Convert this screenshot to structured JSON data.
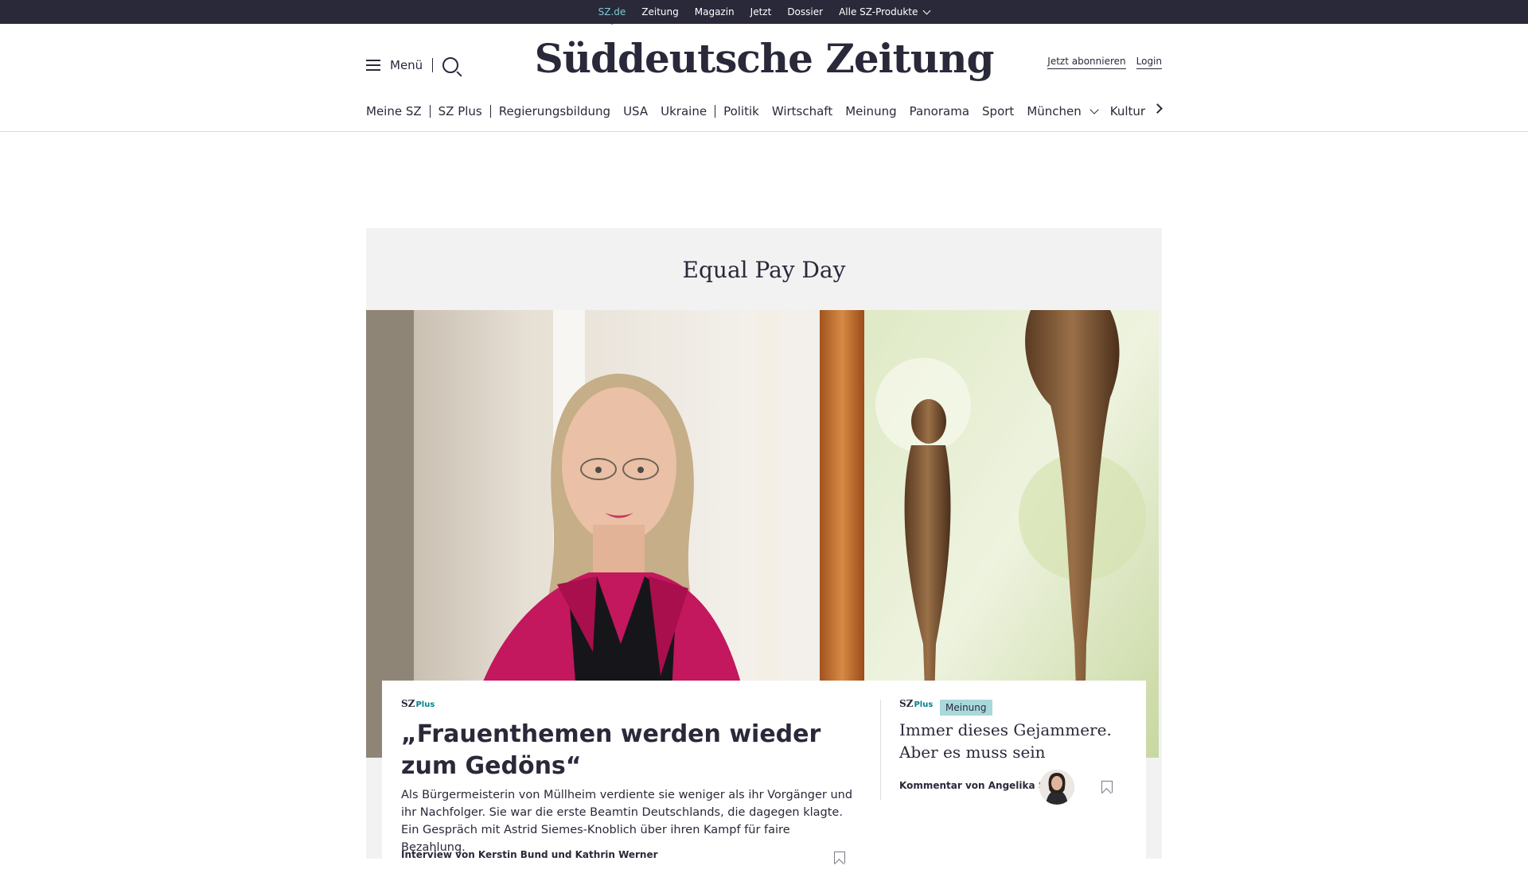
{
  "topbar": {
    "links": [
      "SZ.de",
      "Zeitung",
      "Magazin",
      "Jetzt",
      "Dossier",
      "Alle SZ-Produkte"
    ],
    "active": "SZ.de"
  },
  "header": {
    "menu_label": "Menü",
    "logo": "Süddeutsche Zeitung",
    "subscribe_label": "Jetzt abonnieren",
    "login_label": "Login"
  },
  "nav": {
    "items": [
      "Meine SZ",
      "SZ Plus",
      "Regierungsbildung",
      "USA",
      "Ukraine",
      "Politik",
      "Wirtschaft",
      "Meinung",
      "Panorama",
      "Sport",
      "München",
      "Kultur"
    ]
  },
  "section": {
    "title": "Equal Pay Day"
  },
  "main_article": {
    "badge_sz": "SZ",
    "badge_plus": "Plus",
    "headline": "„Frauenthemen werden wieder zum Gedöns“",
    "teaser": "Als Bürgermeisterin von Müllheim verdiente sie weniger als ihr Vorgänger und ihr Nachfolger. Sie war die erste Beamtin Deutschlands, die dagegen klagte. Ein Gespräch mit Astrid Siemes-Knoblich über ihren Kampf für faire Bezahlung.",
    "author": "Interview von Kerstin Bund und Kathrin Werner"
  },
  "side_article": {
    "badge_sz": "SZ",
    "badge_plus": "Plus",
    "tag": "Meinung",
    "headline": "Immer dieses Gejammere. Aber es muss sein",
    "author": "Kommentar von Angelika Slavik"
  },
  "colors": {
    "dark": "#29293a",
    "accent_teal": "#7ecad0",
    "tag_bg": "#a9d8db",
    "plus_teal": "#00838a"
  }
}
